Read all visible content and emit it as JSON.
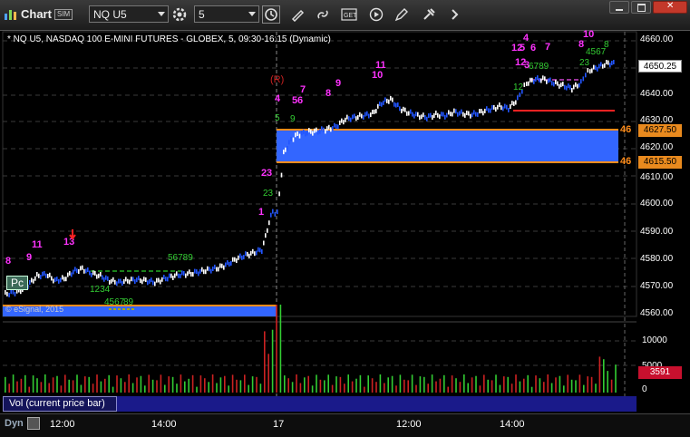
{
  "window": {
    "title": "Chart",
    "sim_badge": "SIM",
    "symbol": "NQ U5",
    "interval": "5",
    "toolbar_icons": [
      "settings-gear-icon",
      "clock-icon",
      "draw-pencil-icon",
      "link-icon",
      "get-icon",
      "play-icon",
      "edit-icon",
      "tools-icon",
      "more-icon"
    ],
    "win_controls": [
      "minimize",
      "maximize",
      "close"
    ]
  },
  "chart": {
    "header": "* NQ U5, NASDAQ 100 E-MINI FUTURES - GLOBEX, 5, 09:30-16:15 (Dynamic)",
    "watermark": "© eSignal, 2015",
    "pc_label": "Pc",
    "price_axis_labels": [
      "4660.00",
      "4640.00",
      "4630.00",
      "4620.00",
      "4610.00",
      "4600.00",
      "4590.00",
      "4580.00",
      "4570.00",
      "4560.00"
    ],
    "last_price": "4650.25",
    "upper_level": "4627.50",
    "lower_level": "4615.50",
    "level_prefix": "46",
    "time_labels": [
      "12:00",
      "14:00",
      "17",
      "12:00",
      "14:00"
    ],
    "colors": {
      "background": "#000000",
      "up_bar": "#ffffff",
      "down_bar": "#2255ff",
      "zone_fill": "#3366ff",
      "zone_border": "#ff8c1a",
      "setup_count": "#ff33ff",
      "green_count": "#33cc33",
      "resistance_line": "#ff2222"
    },
    "td_labels": [
      {
        "text": "8",
        "color": "magenta"
      },
      {
        "text": "9",
        "color": "magenta"
      },
      {
        "text": "11",
        "color": "magenta"
      },
      {
        "text": "13",
        "color": "magenta"
      },
      {
        "text": "11",
        "color": "magenta"
      },
      {
        "text": "1234",
        "color": "green"
      },
      {
        "text": "56789",
        "color": "green"
      },
      {
        "text": "4567",
        "color": "green"
      },
      {
        "text": "89",
        "color": "green"
      },
      {
        "text": "1",
        "color": "magenta"
      },
      {
        "text": "2",
        "color": "magenta"
      },
      {
        "text": "3",
        "color": "magenta"
      },
      {
        "text": "(R)",
        "color": "red"
      },
      {
        "text": "4",
        "color": "magenta"
      },
      {
        "text": "5",
        "color": "magenta"
      },
      {
        "text": "6",
        "color": "magenta"
      },
      {
        "text": "7",
        "color": "magenta"
      },
      {
        "text": "8",
        "color": "magenta"
      },
      {
        "text": "9",
        "color": "magenta"
      },
      {
        "text": "11",
        "color": "magenta"
      },
      {
        "text": "10",
        "color": "magenta"
      },
      {
        "text": "4",
        "color": "magenta"
      },
      {
        "text": "5",
        "color": "magenta"
      },
      {
        "text": "6",
        "color": "magenta"
      },
      {
        "text": "7",
        "color": "magenta"
      },
      {
        "text": "12",
        "color": "magenta"
      },
      {
        "text": "6789",
        "color": "green"
      },
      {
        "text": "10",
        "color": "magenta"
      }
    ]
  },
  "volume": {
    "study_label": "Vol (current price bar)",
    "value": "3591",
    "scale_labels": [
      "10000",
      "5000",
      "0"
    ]
  }
}
